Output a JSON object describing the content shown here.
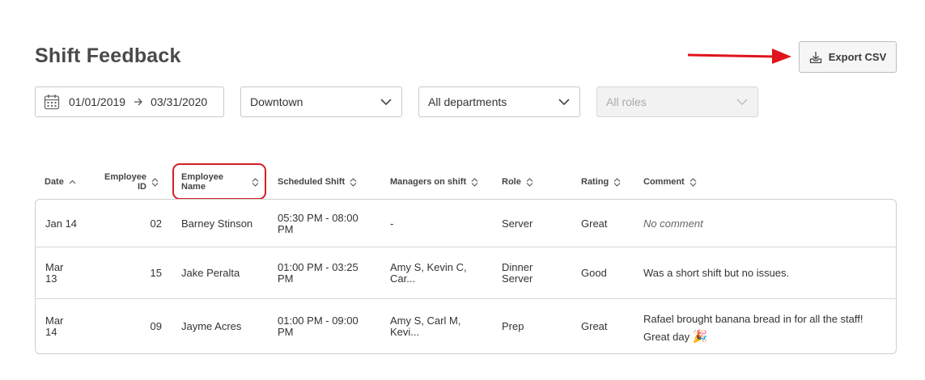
{
  "page": {
    "title": "Shift Feedback"
  },
  "toolbar": {
    "export_label": "Export CSV"
  },
  "filters": {
    "date_start": "01/01/2019",
    "date_end": "03/31/2020",
    "location": "Downtown",
    "department": "All departments",
    "role_placeholder": "All roles"
  },
  "table": {
    "headers": {
      "date": "Date",
      "employee_id_1": "Employee",
      "employee_id_2": "ID",
      "employee_name_1": "Employee",
      "employee_name_2": "Name",
      "scheduled_shift": "Scheduled Shift",
      "managers": "Managers on shift",
      "role": "Role",
      "rating": "Rating",
      "comment": "Comment"
    },
    "rows": [
      {
        "date_1": "Jan 14",
        "date_2": "",
        "id": "02",
        "name": "Barney Stinson",
        "shift_1": "05:30 PM - 08:00",
        "shift_2": "PM",
        "managers_1": "-",
        "managers_2": "",
        "role_1": "Server",
        "role_2": "",
        "rating": "Great",
        "comment_1": "No comment",
        "comment_2": ""
      },
      {
        "date_1": "Mar",
        "date_2": "13",
        "id": "15",
        "name": "Jake Peralta",
        "shift_1": "01:00 PM - 03:25",
        "shift_2": "PM",
        "managers_1": "Amy S, Kevin C,",
        "managers_2": "Car...",
        "role_1": "Dinner",
        "role_2": "Server",
        "rating": "Good",
        "comment_1": "Was a short shift but no issues.",
        "comment_2": ""
      },
      {
        "date_1": "Mar",
        "date_2": "14",
        "id": "09",
        "name": "Jayme Acres",
        "shift_1": "01:00 PM - 09:00",
        "shift_2": "PM",
        "managers_1": "Amy S, Carl M,",
        "managers_2": "Kevi...",
        "role_1": "Prep",
        "role_2": "",
        "rating": "Great",
        "comment_1": "Rafael brought banana bread in for all the staff!",
        "comment_2": "Great day",
        "comment_emoji": "🎉"
      }
    ]
  },
  "icons": {
    "calendar": "calendar-icon",
    "export": "download-tray-icon",
    "chevron": "chevron-down-icon",
    "sort": "sort-icon"
  },
  "colors": {
    "annotation_red": "#d61f26"
  }
}
